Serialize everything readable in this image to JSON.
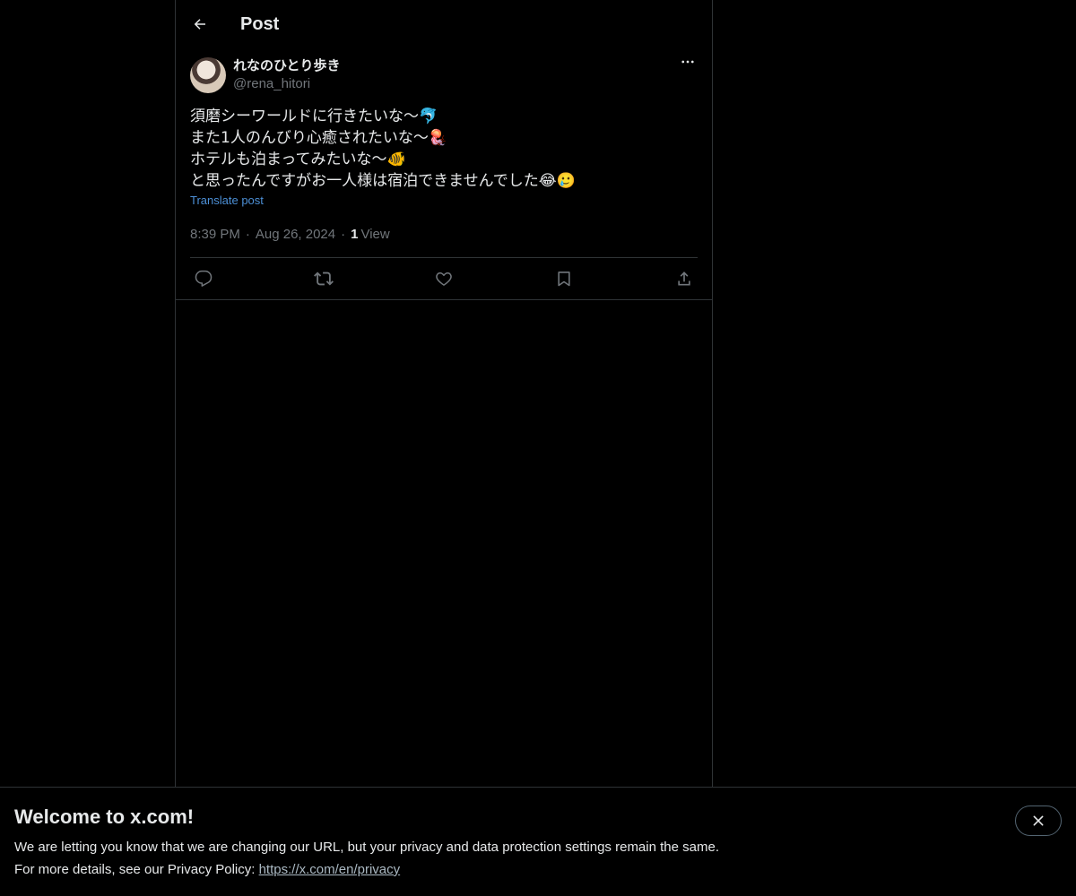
{
  "header": {
    "title": "Post"
  },
  "post": {
    "author": {
      "display_name": "れなのひとり歩き",
      "handle": "@rena_hitori"
    },
    "lines": [
      "須磨シーワールドに行きたいな〜🐬",
      "また1人のんびり心癒されたいな〜🪼",
      "ホテルも泊まってみたいな〜🐠",
      "と思ったんですがお一人様は宿泊できませんでした😂🥲"
    ],
    "translate_label": "Translate post",
    "time": "8:39 PM",
    "separator": "·",
    "date": "Aug 26, 2024",
    "views_count": "1",
    "views_label": "View"
  },
  "actions": {
    "icons": [
      "reply-icon",
      "repost-icon",
      "like-icon",
      "bookmark-icon",
      "share-icon"
    ]
  },
  "banner": {
    "title": "Welcome to x.com!",
    "line1": "We are letting you know that we are changing our URL, but your privacy and data protection settings remain the same.",
    "line2_prefix": "For more details, see our Privacy Policy: ",
    "link": "https://x.com/en/privacy"
  },
  "colors": {
    "background": "#000000",
    "text": "#e7e9ea",
    "muted": "#71767b",
    "link": "#4c8fd6",
    "border": "#2f3336"
  }
}
